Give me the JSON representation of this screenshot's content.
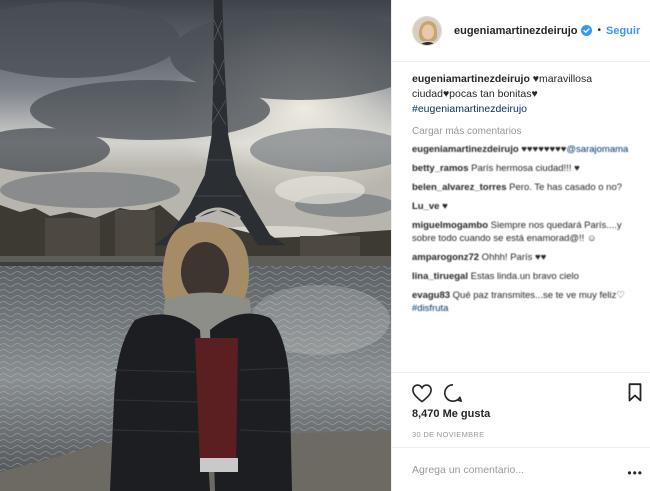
{
  "header": {
    "username": "eugeniamartinezdeirujo",
    "separator": "•",
    "follow_label": "Seguir",
    "verified_icon": "verified-badge-icon"
  },
  "caption": {
    "username": "eugeniamartinezdeirujo",
    "text": "♥maravillosa ciudad♥pocas tan bonitas♥",
    "hashtag": "#eugeniamartinezdeirujo"
  },
  "load_more_label": "Cargar más comentarios",
  "comments": [
    {
      "user": "eugeniamartinezdeirujo",
      "mention": "@sarajomama",
      "text": " ♥♥♥♥♥♥♥♥"
    },
    {
      "user": "betty_ramos",
      "mention": "",
      "text": " París hermosa ciudad!!! ♥"
    },
    {
      "user": "belen_alvarez_torres",
      "mention": "",
      "text": " Pero. Te has casado o no?"
    },
    {
      "user": "Lu_ve",
      "mention": "",
      "text": " ♥"
    },
    {
      "user": "miguelmogambo",
      "mention": "",
      "text": " Siempre nos quedará París....y sobre todo cuando se está enamorad@!! ☺"
    },
    {
      "user": "amparogonz72",
      "mention": "",
      "text": " Ohhh! París ♥♥"
    },
    {
      "user": "lina_tiruegal",
      "mention": "",
      "text": " Estas linda.un bravo cielo"
    },
    {
      "user": "evagu83",
      "mention": "#disfruta",
      "text": " Qué paz transmites...se te ve muy feliz♡ "
    }
  ],
  "actions": {
    "like_icon": "heart-icon",
    "comment_icon": "comment-icon",
    "save_icon": "bookmark-icon"
  },
  "likes": "8,470 Me gusta",
  "date": "30 DE NOVIEMBRE",
  "add_comment": {
    "placeholder": "Agrega un comentario...",
    "value": ""
  },
  "more_icon": "more-options-icon",
  "colors": {
    "link": "#3897f0",
    "mention": "#003569",
    "muted": "#999999",
    "text": "#262626"
  }
}
